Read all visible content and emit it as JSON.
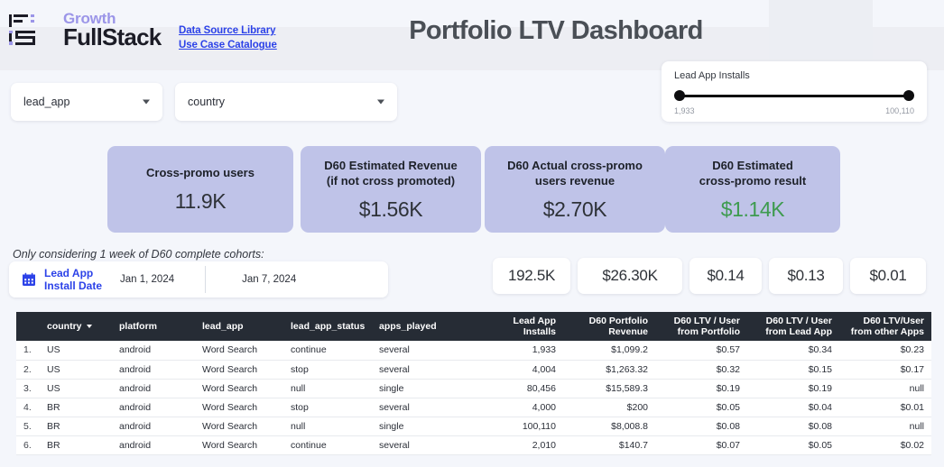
{
  "header": {
    "logo_growth": "Growth",
    "logo_fullstack": "FullStack",
    "links": [
      {
        "label": "Data Source Library"
      },
      {
        "label": "Use Case Catalogue"
      }
    ],
    "title": "Portfolio LTV Dashboard"
  },
  "filters": {
    "lead_app": {
      "value": "lead_app"
    },
    "country": {
      "value": "country"
    }
  },
  "slider": {
    "title": "Lead App Installs",
    "min_label": "1,933",
    "max_label": "100,110"
  },
  "kpis": [
    {
      "label": "Cross-promo users",
      "value": "11.9K",
      "green": false
    },
    {
      "label": "D60 Estimated Revenue\n(if not cross promoted)",
      "line1": "D60 Estimated Revenue",
      "line2": "(if not cross promoted)",
      "value": "$1.56K",
      "green": false
    },
    {
      "line1": "D60 Actual cross-promo",
      "line2": "users revenue",
      "value": "$2.70K",
      "green": false
    },
    {
      "line1": "D60 Estimated",
      "line2": "cross-promo result",
      "value": "$1.14K",
      "green": true
    }
  ],
  "cohort_note": "Only considering 1 week of D60 complete cohorts:",
  "date_filter": {
    "label_line1": "Lead App",
    "label_line2": "Install Date",
    "start": "Jan 1, 2024",
    "end": "Jan 7, 2024",
    "icon": "calendar-icon"
  },
  "pills": [
    {
      "value": "192.5K"
    },
    {
      "value": "$26.30K"
    },
    {
      "value": "$0.14"
    },
    {
      "value": "$0.13"
    },
    {
      "value": "$0.01"
    }
  ],
  "table": {
    "columns": [
      {
        "key": "idx",
        "label": "",
        "align": "left"
      },
      {
        "key": "country",
        "label": "country",
        "align": "left",
        "sorted": true
      },
      {
        "key": "platform",
        "label": "platform",
        "align": "left"
      },
      {
        "key": "lead_app",
        "label": "lead_app",
        "align": "left"
      },
      {
        "key": "lead_app_status",
        "label": "lead_app_status",
        "align": "left"
      },
      {
        "key": "apps_played",
        "label": "apps_played",
        "align": "left"
      },
      {
        "key": "lead_app_installs",
        "line1": "Lead App",
        "line2": "Installs",
        "align": "right"
      },
      {
        "key": "d60_portfolio_revenue",
        "line1": "D60 Portfolio",
        "line2": "Revenue",
        "align": "right"
      },
      {
        "key": "d60_ltv_user_portfolio",
        "line1": "D60 LTV / User",
        "line2": "from Portfolio",
        "align": "right"
      },
      {
        "key": "d60_ltv_user_lead_app",
        "line1": "D60 LTV / User",
        "line2": "from Lead App",
        "align": "right"
      },
      {
        "key": "d60_ltv_user_other_apps",
        "line1": "D60 LTV/User",
        "line2": "from other Apps",
        "align": "right"
      }
    ],
    "rows": [
      {
        "idx": "1.",
        "country": "US",
        "platform": "android",
        "lead_app": "Word Search",
        "lead_app_status": "continue",
        "apps_played": "several",
        "lead_app_installs": "1,933",
        "d60_portfolio_revenue": "$1,099.2",
        "d60_ltv_user_portfolio": "$0.57",
        "d60_ltv_user_lead_app": "$0.34",
        "d60_ltv_user_other_apps": "$0.23"
      },
      {
        "idx": "2.",
        "country": "US",
        "platform": "android",
        "lead_app": "Word Search",
        "lead_app_status": "stop",
        "apps_played": "several",
        "lead_app_installs": "4,004",
        "d60_portfolio_revenue": "$1,263.32",
        "d60_ltv_user_portfolio": "$0.32",
        "d60_ltv_user_lead_app": "$0.15",
        "d60_ltv_user_other_apps": "$0.17"
      },
      {
        "idx": "3.",
        "country": "US",
        "platform": "android",
        "lead_app": "Word Search",
        "lead_app_status": "null",
        "apps_played": "single",
        "lead_app_installs": "80,456",
        "d60_portfolio_revenue": "$15,589.3",
        "d60_ltv_user_portfolio": "$0.19",
        "d60_ltv_user_lead_app": "$0.19",
        "d60_ltv_user_other_apps": "null"
      },
      {
        "idx": "4.",
        "country": "BR",
        "platform": "android",
        "lead_app": "Word Search",
        "lead_app_status": "stop",
        "apps_played": "several",
        "lead_app_installs": "4,000",
        "d60_portfolio_revenue": "$200",
        "d60_ltv_user_portfolio": "$0.05",
        "d60_ltv_user_lead_app": "$0.04",
        "d60_ltv_user_other_apps": "$0.01"
      },
      {
        "idx": "5.",
        "country": "BR",
        "platform": "android",
        "lead_app": "Word Search",
        "lead_app_status": "null",
        "apps_played": "single",
        "lead_app_installs": "100,110",
        "d60_portfolio_revenue": "$8,008.8",
        "d60_ltv_user_portfolio": "$0.08",
        "d60_ltv_user_lead_app": "$0.08",
        "d60_ltv_user_other_apps": "null"
      },
      {
        "idx": "6.",
        "country": "BR",
        "platform": "android",
        "lead_app": "Word Search",
        "lead_app_status": "continue",
        "apps_played": "several",
        "lead_app_installs": "2,010",
        "d60_portfolio_revenue": "$140.7",
        "d60_ltv_user_portfolio": "$0.07",
        "d60_ltv_user_lead_app": "$0.05",
        "d60_ltv_user_other_apps": "$0.02"
      }
    ]
  },
  "colors": {
    "page_bg": "#f4f6fb",
    "kpi_card": "#bfc3e8",
    "accent_green": "#3e9b4f",
    "link_blue": "#2c42e8",
    "table_header": "#262c35",
    "logo_purple": "#9b95e8"
  }
}
